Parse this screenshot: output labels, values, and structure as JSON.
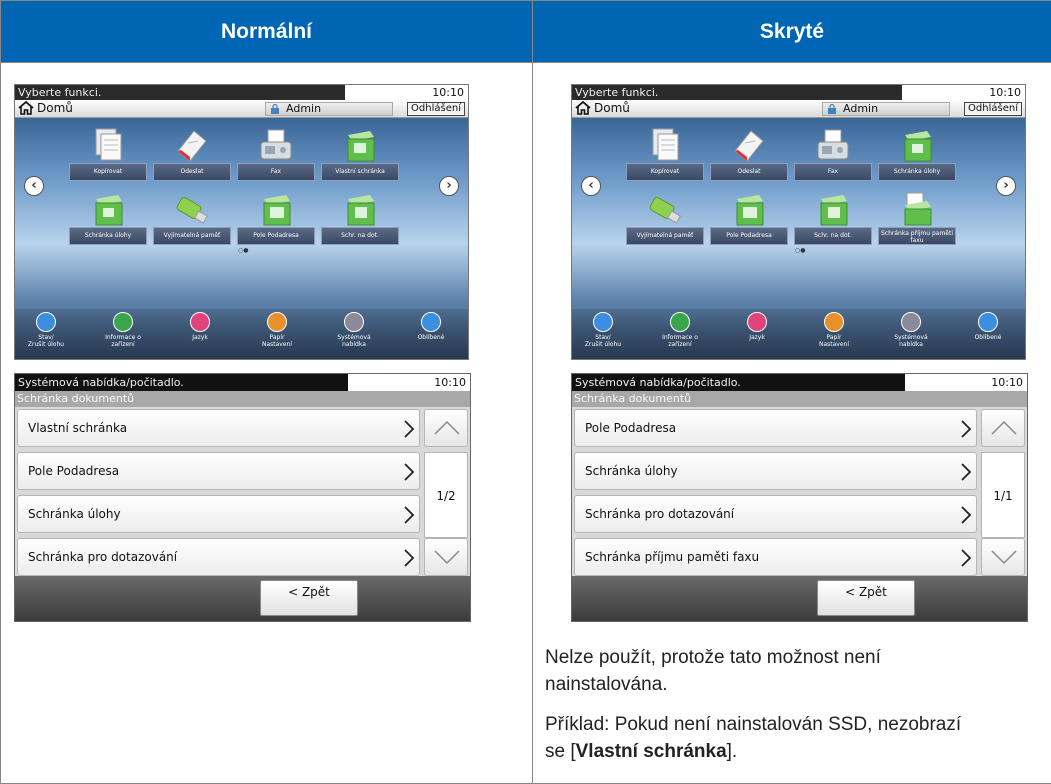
{
  "headers": {
    "left": "Normální",
    "right": "Skryté"
  },
  "left": {
    "home": {
      "prompt": "Vyberte funkci.",
      "time": "10:10",
      "home_label": "Domů",
      "user": "Admin",
      "logout": "Odhlášení",
      "tiles": [
        "Kopírovat",
        "Odeslat",
        "Fax",
        "Vlastní schránka",
        "Schránka úlohy",
        "Vyjímatelná paměť",
        "Pole Podadresa",
        "Schr. na dot."
      ],
      "quick": [
        {
          "l1": "Stav/",
          "l2": "Zrušit úlohu"
        },
        {
          "l1": "Informace o",
          "l2": "zařízení"
        },
        {
          "l1": "Jazyk",
          "l2": ""
        },
        {
          "l1": "Papír",
          "l2": "Nastavení"
        },
        {
          "l1": "Systémová",
          "l2": "nabídka"
        },
        {
          "l1": "Oblíbené",
          "l2": ""
        }
      ]
    },
    "box": {
      "prompt": "Systémová nabídka/počitadlo.",
      "time": "10:10",
      "subtitle": "Schránka dokumentů",
      "rows": [
        "Vlastní schránka",
        "Pole Podadresa",
        "Schránka úlohy",
        "Schránka pro dotazování"
      ],
      "page": "1/2",
      "back": "< Zpět"
    }
  },
  "right": {
    "home": {
      "prompt": "Vyberte funkci.",
      "time": "10:10",
      "home_label": "Domů",
      "user": "Admin",
      "logout": "Odhlášení",
      "tiles": [
        "Kopírovat",
        "Odeslat",
        "Fax",
        "Schránka úlohy",
        "Vyjímatelná paměť",
        "Pole Podadresa",
        "Schr. na dot.",
        "Schránka příjmu paměti faxu"
      ],
      "quick": [
        {
          "l1": "Stav/",
          "l2": "Zrušit úlohu"
        },
        {
          "l1": "Informace o",
          "l2": "zařízení"
        },
        {
          "l1": "Jazyk",
          "l2": ""
        },
        {
          "l1": "Papír",
          "l2": "Nastavení"
        },
        {
          "l1": "Systémová",
          "l2": "nabídka"
        },
        {
          "l1": "Oblíbené",
          "l2": ""
        }
      ]
    },
    "box": {
      "prompt": "Systémová nabídka/počitadlo.",
      "time": "10:10",
      "subtitle": "Schránka dokumentů",
      "rows": [
        "Pole Podadresa",
        "Schránka úlohy",
        "Schránka pro dotazování",
        "Schránka příjmu paměti faxu"
      ],
      "page": "1/1",
      "back": "< Zpět"
    },
    "note1": "Nelze použít, protože tato možnost není nainstalována.",
    "note2_prefix": "Příklad: Pokud není nainstalován SSD, nezobrazí se [",
    "note2_bold": "Vlastní schránka",
    "note2_suffix": "]."
  }
}
